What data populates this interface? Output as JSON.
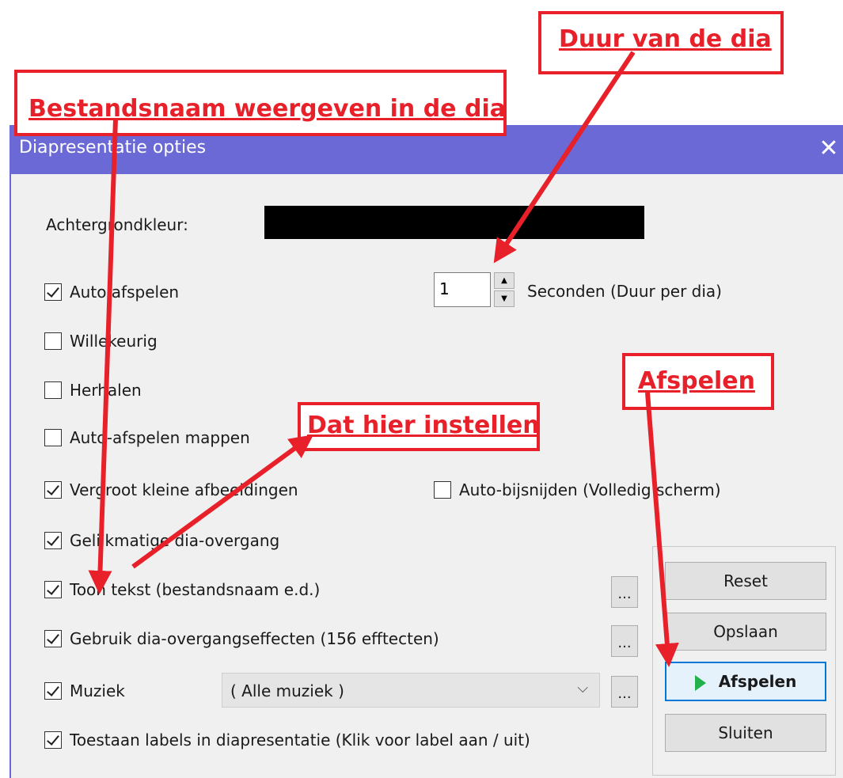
{
  "dialog": {
    "title": "Diapresentatie opties",
    "close_glyph": "✕",
    "background_color_label": "Achtergrondkleur:",
    "background_color_value": "#000000",
    "duration": {
      "value": "1",
      "unit_label": "Seconden (Duur per dia)"
    },
    "checkboxes": [
      {
        "label": "Auto afspelen",
        "checked": true
      },
      {
        "label": "Willekeurig",
        "checked": false
      },
      {
        "label": "Herhalen",
        "checked": false
      },
      {
        "label": "Auto-afspelen mappen",
        "checked": false
      },
      {
        "label": "Vergroot kleine afbeeldingen",
        "checked": true
      },
      {
        "label": "Gelijkmatige dia-overgang",
        "checked": true
      },
      {
        "label": "Toon tekst (bestandsnaam e.d.)",
        "checked": true
      },
      {
        "label": "Gebruik dia-overgangseffecten (156 efftecten)",
        "checked": true
      },
      {
        "label": "Muziek",
        "checked": true
      },
      {
        "label": "Toestaan labels in diapresentatie (Klik voor label aan / uit)",
        "checked": true
      }
    ],
    "auto_crop": {
      "label": "Auto-bijsnijden (Volledig scherm)",
      "checked": false
    },
    "music_select_value": "( Alle muziek )",
    "ellipsis": "...",
    "buttons": {
      "reset": "Reset",
      "save": "Opslaan",
      "play": "Afspelen",
      "close": "Sluiten"
    }
  },
  "annotations": {
    "duration": "Duur van de dia",
    "filename": "Bestandsnaam weergeven in de dia",
    "set_here": "Dat hier instellen",
    "play": "Afspelen",
    "color": "#e8202a"
  }
}
